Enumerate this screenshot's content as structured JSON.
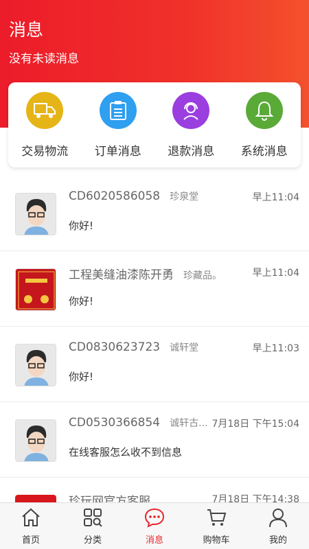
{
  "header": {
    "title": "消息",
    "subtitle": "没有未读消息"
  },
  "categories": [
    {
      "label": "交易物流",
      "color": "#e5b416",
      "icon": "truck-icon"
    },
    {
      "label": "订单消息",
      "color": "#2f9ff0",
      "icon": "clipboard-icon"
    },
    {
      "label": "退款消息",
      "color": "#9a3ee0",
      "icon": "customer-service-icon"
    },
    {
      "label": "系统消息",
      "color": "#5aaa38",
      "icon": "bell-icon"
    }
  ],
  "messages": [
    {
      "name": "CD6020586058",
      "shop": "珍泉堂",
      "time": "早上11:04",
      "text": "你好!",
      "avatar": "cartoon-avatar"
    },
    {
      "name": "工程美缝油漆陈开勇",
      "shop": "珍藏品。",
      "time": "早上11:04",
      "text": "你好!",
      "avatar": "red-festive-avatar"
    },
    {
      "name": "CD0830623723",
      "shop": "诚轩堂",
      "time": "早上11:03",
      "text": "你好!",
      "avatar": "cartoon-avatar"
    },
    {
      "name": "CD0530366854",
      "shop": "诚轩古...",
      "time": "7月18日 下午15:04",
      "text": "在线客服怎么收不到信息",
      "avatar": "cartoon-avatar"
    },
    {
      "name": "珍玩网官方客服",
      "shop": "",
      "time": "7月18日 下午14:38",
      "text": "",
      "avatar": "red-logo-avatar"
    }
  ],
  "tabs": [
    {
      "label": "首页",
      "icon": "home-icon"
    },
    {
      "label": "分类",
      "icon": "category-icon"
    },
    {
      "label": "消息",
      "icon": "message-icon",
      "active": true
    },
    {
      "label": "购物车",
      "icon": "cart-icon"
    },
    {
      "label": "我的",
      "icon": "user-icon"
    }
  ],
  "colors": {
    "brand_red": "#e8242a",
    "header_gradient_end": "#f4512d"
  }
}
